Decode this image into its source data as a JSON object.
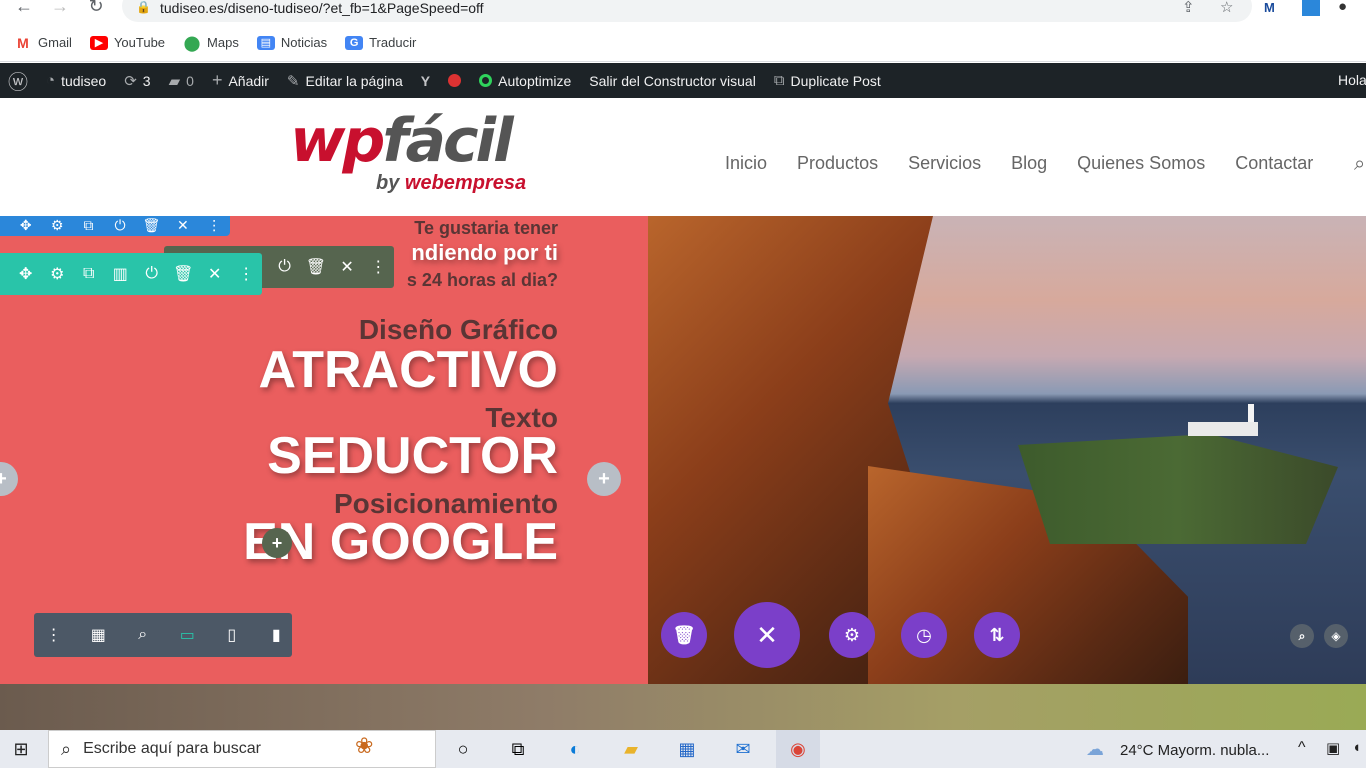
{
  "browser": {
    "url": "tudiseo.es/diseno-tudiseo/?et_fb=1&PageSpeed=off",
    "bookmarks": [
      {
        "label": "Gmail",
        "icon": "gmail-icon"
      },
      {
        "label": "YouTube",
        "icon": "youtube-icon"
      },
      {
        "label": "Maps",
        "icon": "maps-icon"
      },
      {
        "label": "Noticias",
        "icon": "news-icon"
      },
      {
        "label": "Traducir",
        "icon": "translate-icon"
      }
    ]
  },
  "adminbar": {
    "site": "tudiseo",
    "updates": "3",
    "comments": "0",
    "add": "Añadir",
    "edit": "Editar la página",
    "autoptimize": "Autoptimize",
    "exit_builder": "Salir del Constructor visual",
    "duplicate": "Duplicate Post",
    "greeting": "Hola"
  },
  "header": {
    "logo_main_a": "wp",
    "logo_main_b": "fácil",
    "logo_by": "by",
    "logo_brand": "webempresa",
    "menu": [
      "Inicio",
      "Productos",
      "Servicios",
      "Blog",
      "Quienes Somos",
      "Contactar"
    ]
  },
  "hero": {
    "line1": "Te gustaria tener",
    "line2": "ndiendo por ti",
    "line3": "s 24 horas al dia?",
    "small1": "Diseño Gráfico",
    "big1": "ATRACTIVO",
    "small2": "Texto",
    "big2": "SEDUCTOR",
    "small3": "Posicionamiento",
    "big3": "EN GOOGLE"
  },
  "taskbar": {
    "search_placeholder": "Escribe aquí para buscar",
    "weather": "24°C  Mayorm. nubla..."
  },
  "colors": {
    "hero_bg": "#ea5e5e",
    "divi_blue": "#2b87da",
    "divi_green": "#29c4a9",
    "divi_dark": "#4c5866",
    "divi_purple": "#7b3fc9",
    "adminbar": "#1d2327"
  }
}
